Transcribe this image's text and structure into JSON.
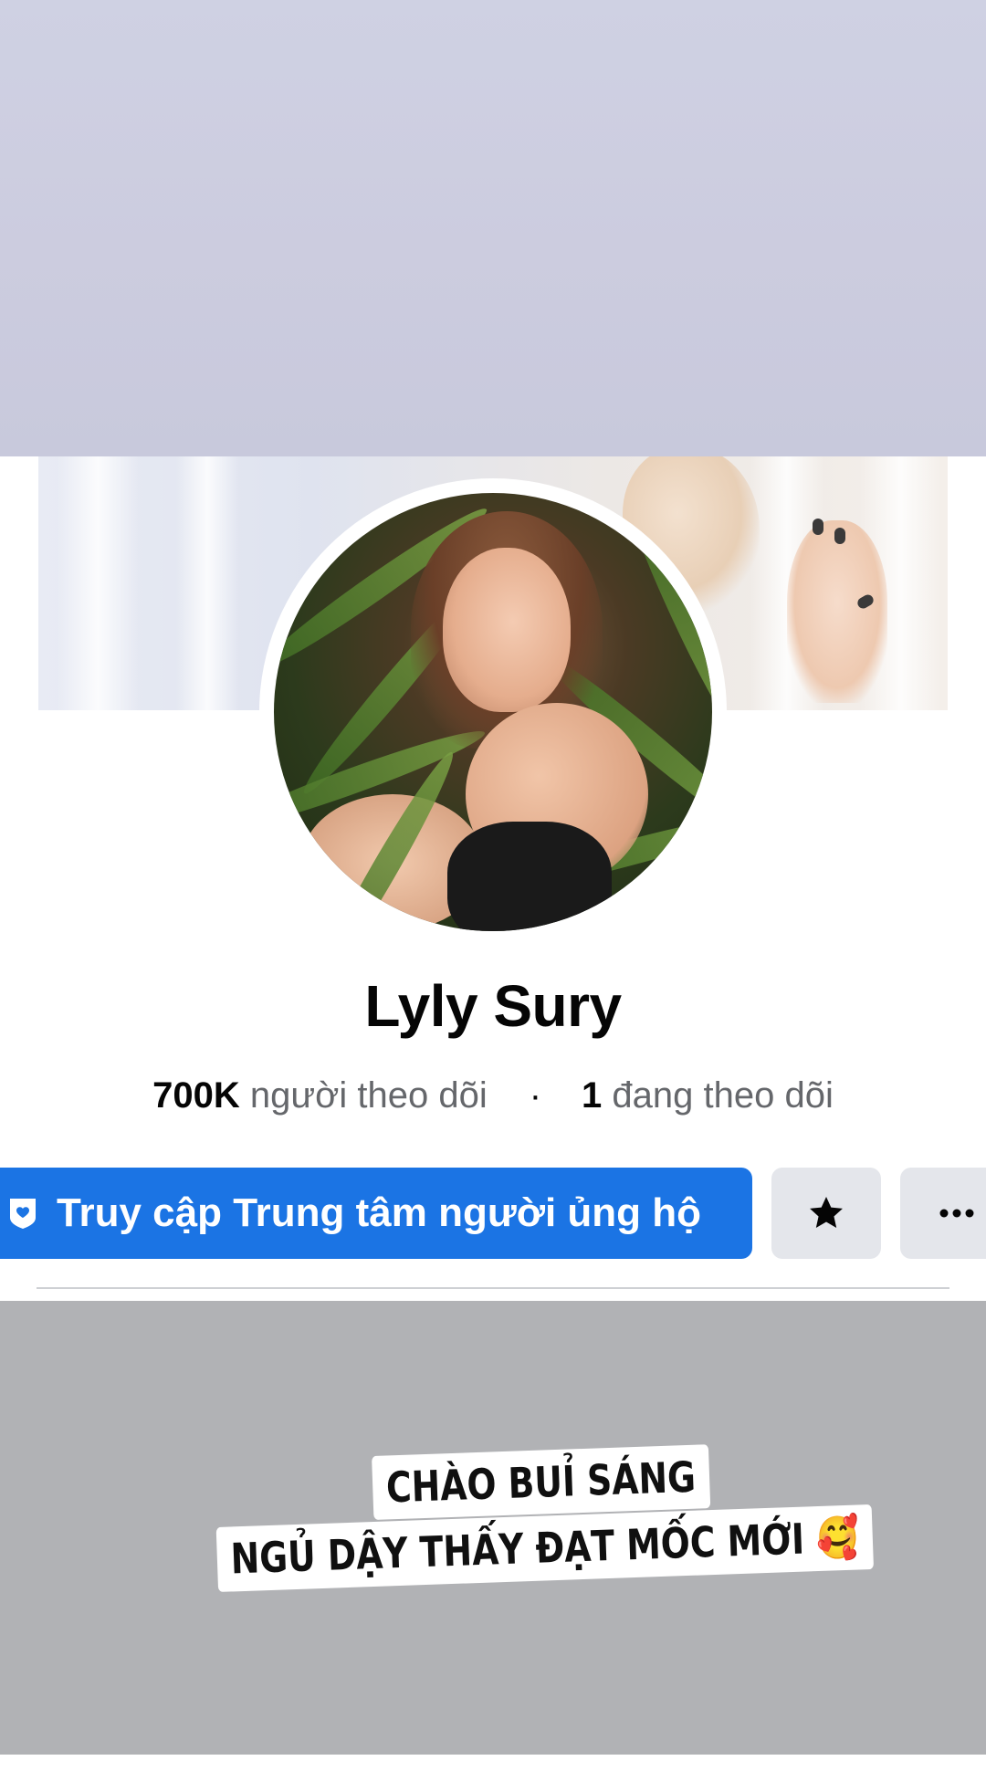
{
  "profile": {
    "name": "Lyly Sury",
    "followers_count": "700K",
    "followers_label": "người theo dõi",
    "separator": "·",
    "following_count": "1",
    "following_label": "đang theo dõi"
  },
  "actions": {
    "support_label": "Truy cập Trung tâm người ủng hộ",
    "star_icon": "star-icon",
    "more_icon": "more-icon"
  },
  "story_caption": {
    "line1": "CHÀO BUỈ SÁNG",
    "line2": "NGỦ DẬY THẤY ĐẠT MỐC MỚI",
    "emoji": "🥰"
  },
  "colors": {
    "accent": "#1b74e4",
    "secondary_button": "#e4e6eb",
    "top_band": "#cccdde",
    "bottom_band": "#b1b2b5"
  }
}
